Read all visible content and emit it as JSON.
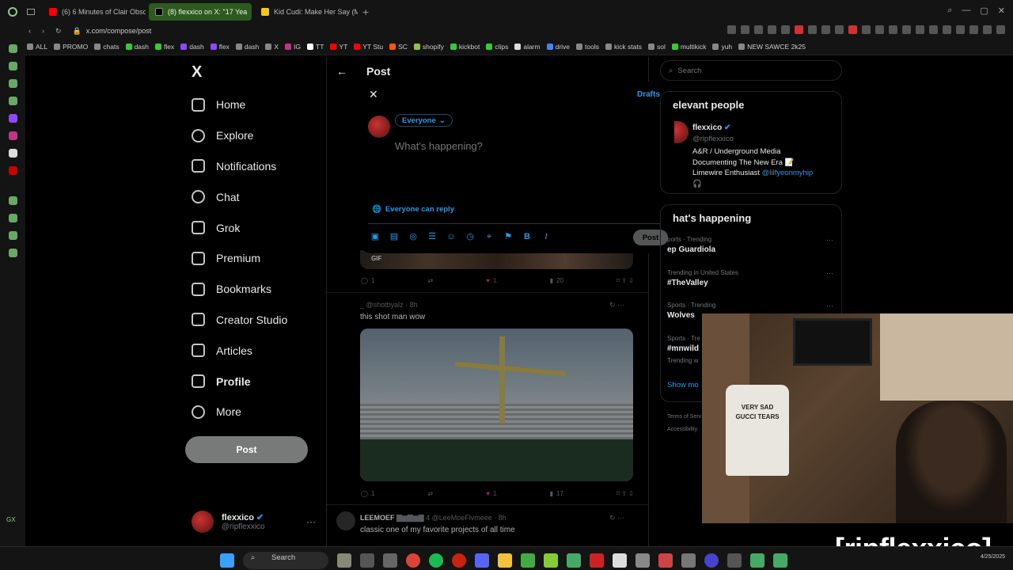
{
  "browser": {
    "tabs": [
      {
        "title": "(6) 6 Minutes of Clair Obsc",
        "color": "#ff0000"
      },
      {
        "title": "(8) flexxico on X: \"17 Yea",
        "color": "#000000",
        "active": true
      },
      {
        "title": "Kid Cudi: Make Her Say (M",
        "color": "#f5c518"
      }
    ],
    "url": "x.com/compose/post",
    "bookmarks": [
      "ALL",
      "PROMO",
      "chats",
      "dash",
      "flex",
      "dash",
      "flex",
      "dash",
      "X",
      "IG",
      "TT",
      "YT",
      "YT Stu",
      "SC",
      "shopify",
      "kickbot",
      "clips",
      "alarm",
      "drive",
      "tools",
      "kick stats",
      "sol",
      "multikick",
      "yuh",
      "NEW SAWCE 2k25"
    ],
    "gx_label": "GX"
  },
  "nav": {
    "logo": "X",
    "items": [
      "Home",
      "Explore",
      "Notifications",
      "Chat",
      "Grok",
      "Premium",
      "Bookmarks",
      "Creator Studio",
      "Articles",
      "Profile",
      "More"
    ],
    "post_label": "Post",
    "account_name": "flexxico",
    "account_handle": "@ripflexxico"
  },
  "post_header": {
    "back": "←",
    "title": "Post"
  },
  "compose": {
    "close": "✕",
    "drafts": "Drafts",
    "audience": "Everyone",
    "placeholder": "What's happening?",
    "reply_setting": "Everyone can reply",
    "post_label": "Post"
  },
  "feed": {
    "gif_label": "GIF",
    "tweet1_actions": {
      "replies": "1",
      "likes": "1",
      "views": "20"
    },
    "tweet2": {
      "user": "_ @shotbyalz · 8h",
      "text": "this shot man wow",
      "actions": {
        "replies": "1",
        "likes": "1",
        "views": "17"
      }
    },
    "tweet3": {
      "user": "LEEMOEF",
      "handle": "4 @LeeMoeFlvmeee · 8h",
      "text": "classic one of my favorite projects of all time"
    }
  },
  "right": {
    "search_placeholder": "Search",
    "relevant_title": "elevant people",
    "person": {
      "name": "flexxico",
      "handle": "@ripflexxico",
      "bio1": "A&R / Underground Media",
      "bio2": "Documenting The New Era 📝",
      "bio3": "Limewire Enthusiast",
      "bio_link": "@lilfyeonmyhip",
      "bio4": "🎧"
    },
    "happening_title": "hat's happening",
    "trends": [
      {
        "meta": "ports · Trending",
        "name": "ep Guardiola"
      },
      {
        "meta": "Trending in United States",
        "name": "#TheValley"
      },
      {
        "meta": "Sports · Trending",
        "name": "Wolves"
      },
      {
        "meta": "Sports · Tre",
        "name": "#mnwild"
      }
    ],
    "trend4_extra": "Trending w",
    "show_more": "Show mo",
    "footer1": "Terms of Serv",
    "footer2": "Accessibility"
  },
  "stream": {
    "overlay": "[ripflexxico]",
    "shirt_line1": "VERY SAD",
    "shirt_line2": "GUCCI TEARS"
  },
  "taskbar": {
    "search_label": "Search",
    "date": "4/25/2025"
  }
}
